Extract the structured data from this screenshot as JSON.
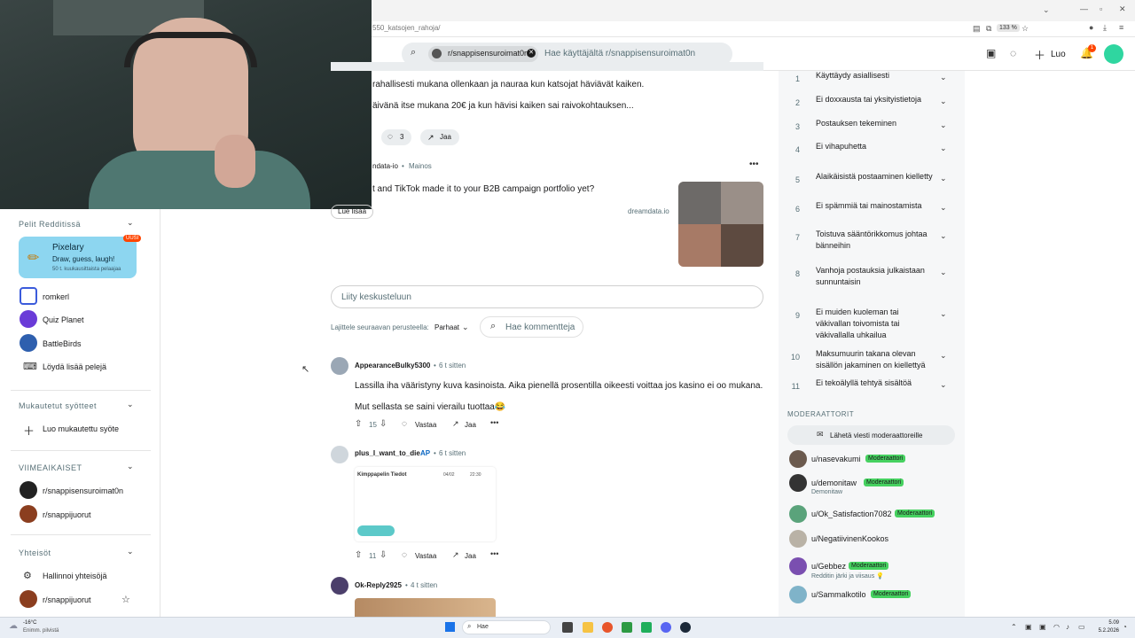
{
  "browser": {
    "url": "550_katsojen_rahoja/",
    "zoom": "133 %"
  },
  "header": {
    "search_chip": "r/snappisensuroimat0n",
    "search_placeholder": "Hae käyttäjältä r/snappisensuroimat0n",
    "create_label": "Luo",
    "notif_count": "1"
  },
  "post": {
    "line1": "rahallisesti mukana ollenkaan ja nauraa kun katsojat häviävät kaiken.",
    "line2": "äivänä itse mukana 20€ ja kun hävisi kaiken sai raivokohtauksen...",
    "comments_count": "3",
    "share_label": "Jaa"
  },
  "ad": {
    "advertiser": "ndata-io",
    "ad_label": "Mainos",
    "text": "t and TikTok made it to your B2B campaign portfolio yet?",
    "domain": "dreamdata.io",
    "read_more": "Lue lisää"
  },
  "comments_section": {
    "join_placeholder": "Liity keskusteluun",
    "sort_label": "Lajittele seuraavan perusteella:",
    "sort_value": "Parhaat",
    "search_placeholder": "Hae kommentteja"
  },
  "comments": [
    {
      "author": "AppearanceBulky5300",
      "time": "6 t sitten",
      "text1": "Lassilla iha vääristyny kuva kasinoista. Aika pienellä prosentilla oikeesti voittaa jos kasino ei oo mukana.",
      "text2": "Mut sellasta se saini vierailu tuottaa😂",
      "votes": "15",
      "reply": "Vastaa",
      "share": "Jaa"
    },
    {
      "author": "plus_I_want_to_die",
      "op_badge": "AP",
      "time": "6 t sitten",
      "image_title": "Kimppapelin Tiedot",
      "image_date": "04/02",
      "image_time": "22:30",
      "votes": "11",
      "reply": "Vastaa",
      "share": "Jaa"
    },
    {
      "author": "Ok-Reply2925",
      "time": "4 t sitten"
    }
  ],
  "left_sidebar": {
    "games_title": "Pelit Redditissä",
    "pixelary": {
      "name": "Pixelary",
      "desc": "Draw, guess, laugh!",
      "players": "50 t. kuukausittaista pelaajaa",
      "badge": "UUSI"
    },
    "games": [
      "romkerl",
      "Quiz Planet",
      "BattleBirds"
    ],
    "find_more": "Löydä lisää pelejä",
    "custom_feeds_title": "Mukautetut syötteet",
    "create_feed": "Luo mukautettu syöte",
    "recent_title": "VIIMEAIKAISET",
    "recent": [
      "r/snappisensuroimat0n",
      "r/snappijuorut"
    ],
    "communities_title": "Yhteisöt",
    "manage_communities": "Hallinnoi yhteisöjä",
    "communities": [
      "r/snappijuorut"
    ]
  },
  "rules": [
    {
      "num": "1",
      "text": "Käyttäydy asiallisesti"
    },
    {
      "num": "2",
      "text": "Ei doxxausta tai yksityistietoja"
    },
    {
      "num": "3",
      "text": "Postauksen tekeminen"
    },
    {
      "num": "4",
      "text": "Ei vihapuhetta"
    },
    {
      "num": "5",
      "text": "Alaikäisistä postaaminen kielletty"
    },
    {
      "num": "6",
      "text": "Ei spämmiä tai mainostamista"
    },
    {
      "num": "7",
      "text": "Toistuva sääntörikkomus johtaa bänneihin"
    },
    {
      "num": "8",
      "text": "Vanhoja postauksia julkaistaan sunnuntaisin"
    },
    {
      "num": "9",
      "text": "Ei muiden kuoleman tai väkivallan toivomista tai väkivallalla uhkailua"
    },
    {
      "num": "10",
      "text": "Maksumuurin takana olevan sisällön jakaminen on kiellettyä"
    },
    {
      "num": "11",
      "text": "Ei tekoälyllä tehtyä sisältöä"
    }
  ],
  "moderators": {
    "title": "MODERAATTORIT",
    "message_button": "Lähetä viesti moderaattoreille",
    "badge_label": "Moderaattori",
    "list": [
      {
        "name": "u/nasevakumi",
        "sub": ""
      },
      {
        "name": "u/demonitaw",
        "sub": "Demonitaw"
      },
      {
        "name": "u/Ok_Satisfaction7082",
        "sub": ""
      },
      {
        "name": "u/NegatiivinenKookos",
        "sub": ""
      },
      {
        "name": "u/Gebbez",
        "sub": "Redditin järki ja viisaus 💡"
      },
      {
        "name": "u/Sammalkotilo",
        "sub": ""
      }
    ]
  },
  "taskbar": {
    "weather_temp": "-16°C",
    "weather_desc": "Enimm. pilvistä",
    "search_placeholder": "Hae",
    "time": "5.09",
    "date": "5.2.2026"
  }
}
